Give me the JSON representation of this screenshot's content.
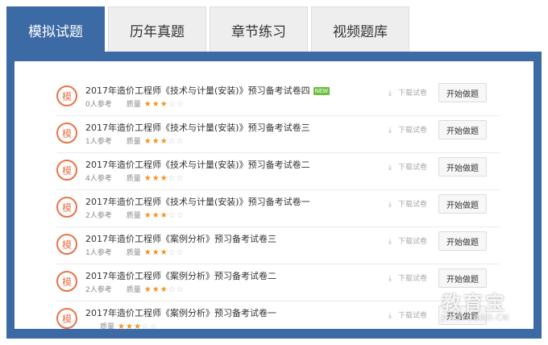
{
  "tabs": [
    {
      "label": "模拟试题"
    },
    {
      "label": "历年真题"
    },
    {
      "label": "章节练习"
    },
    {
      "label": "视频题库"
    }
  ],
  "exam_badge": "模",
  "new_tag": "NEW",
  "quality_label": "质量",
  "download_label": "下载试卷",
  "start_label": "开始做题",
  "colors": {
    "accent": "#3c6aa5",
    "badge": "#e8734a",
    "star": "#f29423"
  },
  "exams": [
    {
      "title": "2017年造价工程师《技术与计量(安装)》预习备考试卷四",
      "participants": "0人参考",
      "stars": 3,
      "is_new": true
    },
    {
      "title": "2017年造价工程师《技术与计量(安装)》预习备考试卷三",
      "participants": "1人参考",
      "stars": 3,
      "is_new": false
    },
    {
      "title": "2017年造价工程师《技术与计量(安装)》预习备考试卷二",
      "participants": "4人参考",
      "stars": 3,
      "is_new": false
    },
    {
      "title": "2017年造价工程师《技术与计量(安装)》预习备考试卷一",
      "participants": "2人参考",
      "stars": 3,
      "is_new": false
    },
    {
      "title": "2017年造价工程师《案例分析》预习备考试卷三",
      "participants": "1人参考",
      "stars": 3,
      "is_new": false
    },
    {
      "title": "2017年造价工程师《案例分析》预习备考试卷二",
      "participants": "2人参考",
      "stars": 3,
      "is_new": false
    },
    {
      "title": "2017年造价工程师《案例分析》预习备考试卷一",
      "participants": "",
      "stars": 3,
      "is_new": false
    }
  ],
  "watermark": {
    "main": "教育宝",
    "sub": "JIAOYUBAO.CN"
  }
}
